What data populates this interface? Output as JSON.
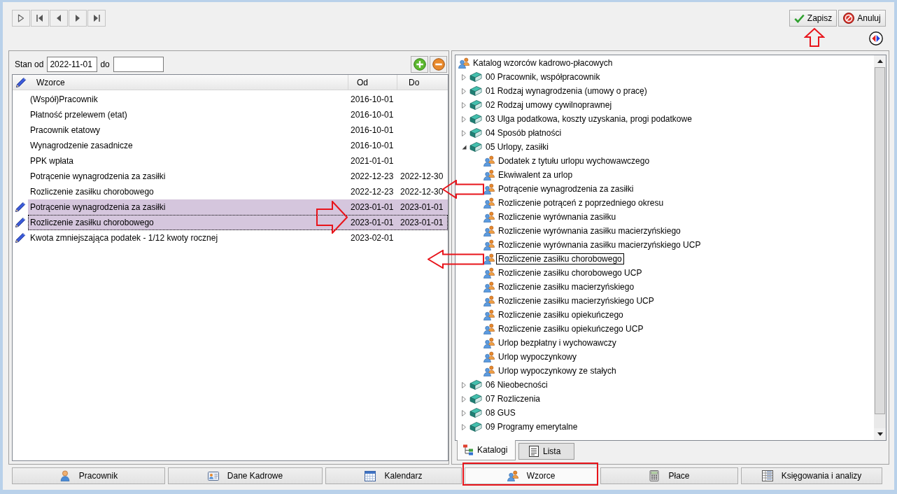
{
  "toolbar": {
    "actions": [
      {
        "label": "Zapisz",
        "kind": "save"
      },
      {
        "label": "Anuluj",
        "kind": "cancel"
      }
    ]
  },
  "filter": {
    "from_label": "Stan od",
    "from_value": "2022-11-01",
    "to_label": "do"
  },
  "table": {
    "columns": [
      "Wzorce",
      "Od",
      "Do"
    ],
    "rows": [
      {
        "name": "(Współ)Pracownik",
        "from": "2016-10-01",
        "pencil": false,
        "selected": false,
        "focused": false
      },
      {
        "name": "Płatność przelewem (etat)",
        "from": "2016-10-01",
        "pencil": false,
        "selected": false,
        "focused": false
      },
      {
        "name": "Pracownik etatowy",
        "from": "2016-10-01",
        "pencil": false,
        "selected": false,
        "focused": false
      },
      {
        "name": "Wynagrodzenie zasadnicze",
        "from": "2016-10-01",
        "pencil": false,
        "selected": false,
        "focused": false
      },
      {
        "name": "PPK wpłata",
        "from": "2021-01-01",
        "pencil": false,
        "selected": false,
        "focused": false
      },
      {
        "name": "Potrącenie wynagrodzenia za zasiłki",
        "from": "2022-12-23",
        "to": "2022-12-30",
        "pencil": false,
        "selected": false,
        "focused": false
      },
      {
        "name": "Rozliczenie zasiłku chorobowego",
        "from": "2022-12-23",
        "to": "2022-12-30",
        "pencil": false,
        "selected": false,
        "focused": false
      },
      {
        "name": "Potrącenie wynagrodzenia za zasiłki",
        "from": "2023-01-01",
        "to": "2023-01-01",
        "pencil": true,
        "selected": true,
        "focused": false
      },
      {
        "name": "Rozliczenie zasiłku chorobowego",
        "from": "2023-01-01",
        "to": "2023-01-01",
        "pencil": true,
        "selected": true,
        "focused": true
      },
      {
        "name": "Kwota zmniejszająca podatek - 1/12 kwoty rocznej",
        "from": "2023-02-01",
        "pencil": true,
        "selected": false,
        "focused": false
      }
    ]
  },
  "tree": {
    "label": "Katalog wzorców kadrowo-płacowych",
    "selected": false,
    "children": [
      {
        "kind": "folder",
        "label": "00 Pracownik, współpracownik",
        "expanded": false,
        "selected": false
      },
      {
        "kind": "folder",
        "label": "01 Rodzaj wynagrodzenia (umowy o pracę)",
        "expanded": false,
        "selected": false
      },
      {
        "kind": "folder",
        "label": "02 Rodzaj umowy cywilnoprawnej",
        "expanded": false,
        "selected": false
      },
      {
        "kind": "folder",
        "label": "03 Ulga podatkowa, koszty uzyskania, progi podatkowe",
        "expanded": false,
        "selected": false
      },
      {
        "kind": "folder",
        "label": "04 Sposób płatności",
        "expanded": false,
        "selected": false
      },
      {
        "kind": "folder",
        "label": "05 Urlopy, zasiłki",
        "expanded": true,
        "selected": false,
        "children": [
          {
            "kind": "template",
            "label": "Dodatek z tytułu urlopu wychowawczego",
            "selected": false
          },
          {
            "kind": "template",
            "label": "Ekwiwalent za urlop",
            "selected": false
          },
          {
            "kind": "template",
            "label": "Potrącenie wynagrodzenia za zasiłki",
            "selected": false
          },
          {
            "kind": "template",
            "label": "Rozliczenie potrąceń z poprzedniego okresu",
            "selected": false
          },
          {
            "kind": "template",
            "label": "Rozliczenie wyrównania zasiłku",
            "selected": false
          },
          {
            "kind": "template",
            "label": "Rozliczenie wyrównania zasiłku macierzyńskiego",
            "selected": false
          },
          {
            "kind": "template",
            "label": "Rozliczenie wyrównania zasiłku macierzyńskiego UCP",
            "selected": false
          },
          {
            "kind": "template",
            "label": "Rozliczenie zasiłku chorobowego",
            "selected": true
          },
          {
            "kind": "template",
            "label": "Rozliczenie zasiłku chorobowego UCP",
            "selected": false
          },
          {
            "kind": "template",
            "label": "Rozliczenie zasiłku macierzyńskiego",
            "selected": false
          },
          {
            "kind": "template",
            "label": "Rozliczenie zasiłku macierzyńskiego UCP",
            "selected": false
          },
          {
            "kind": "template",
            "label": "Rozliczenie zasiłku opiekuńczego",
            "selected": false
          },
          {
            "kind": "template",
            "label": "Rozliczenie zasiłku opiekuńczego UCP",
            "selected": false
          },
          {
            "kind": "template",
            "label": "Urlop bezpłatny i wychowawczy",
            "selected": false
          },
          {
            "kind": "template",
            "label": "Urlop wypoczynkowy",
            "selected": false
          },
          {
            "kind": "template",
            "label": "Urlop wypoczynkowy ze stałych",
            "selected": false
          }
        ]
      },
      {
        "kind": "folder",
        "label": "06 Nieobecności",
        "expanded": false,
        "selected": false
      },
      {
        "kind": "folder",
        "label": "07 Rozliczenia",
        "expanded": false,
        "selected": false
      },
      {
        "kind": "folder",
        "label": "08 GUS",
        "expanded": false,
        "selected": false
      },
      {
        "kind": "folder",
        "label": "09 Programy emerytalne",
        "expanded": false,
        "selected": false
      }
    ]
  },
  "panel_tabs": [
    {
      "label": "Katalogi",
      "selected": true
    },
    {
      "label": "Lista",
      "selected": false
    }
  ],
  "module_tabs": [
    {
      "label": "Pracownik",
      "selected": false
    },
    {
      "label": "Dane Kadrowe",
      "selected": false
    },
    {
      "label": "Kalendarz",
      "selected": false
    },
    {
      "label": "Wzorce",
      "selected": true
    },
    {
      "label": "Płace",
      "selected": false
    },
    {
      "label": "Księgowania i analizy",
      "selected": false
    }
  ]
}
